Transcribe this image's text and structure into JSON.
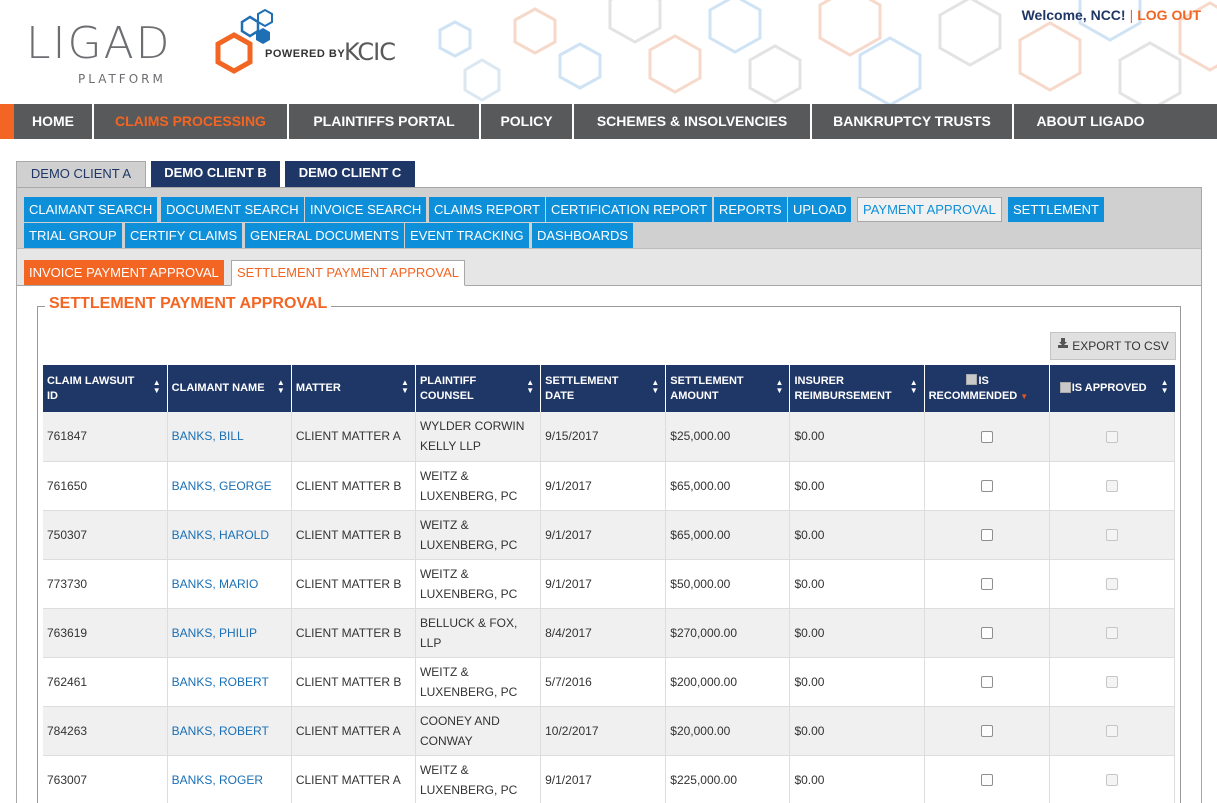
{
  "brand": {
    "logo_text": "LIGAD",
    "logo_sub": "PLATFORM",
    "powered_by": "POWERED BY",
    "partner": "KCIC"
  },
  "user": {
    "welcome": "Welcome, NCC!",
    "separator": "|",
    "logout": "LOG OUT"
  },
  "main_nav": [
    {
      "label": "HOME"
    },
    {
      "label": "CLAIMS PROCESSING",
      "active": true
    },
    {
      "label": "PLAINTIFFS PORTAL"
    },
    {
      "label": "POLICY"
    },
    {
      "label": "SCHEMES & INSOLVENCIES"
    },
    {
      "label": "BANKRUPTCY TRUSTS"
    },
    {
      "label": "ABOUT LIGADO"
    }
  ],
  "client_tabs": [
    {
      "label": "DEMO CLIENT A",
      "active": true
    },
    {
      "label": "DEMO CLIENT B"
    },
    {
      "label": "DEMO CLIENT C"
    }
  ],
  "sub_tabs": [
    {
      "label": "CLAIMANT SEARCH"
    },
    {
      "label": "DOCUMENT SEARCH"
    },
    {
      "label": "INVOICE SEARCH"
    },
    {
      "label": "CLAIMS REPORT"
    },
    {
      "label": "CERTIFICATION REPORT"
    },
    {
      "label": "REPORTS"
    },
    {
      "label": "UPLOAD"
    },
    {
      "label": "PAYMENT APPROVAL",
      "active": true
    },
    {
      "label": "SETTLEMENT"
    },
    {
      "label": "TRIAL GROUP"
    },
    {
      "label": "CERTIFY CLAIMS"
    },
    {
      "label": "GENERAL DOCUMENTS"
    },
    {
      "label": "EVENT TRACKING"
    },
    {
      "label": "DASHBOARDS"
    }
  ],
  "approval_tabs": [
    {
      "label": "INVOICE PAYMENT APPROVAL"
    },
    {
      "label": "SETTLEMENT PAYMENT APPROVAL",
      "active": true
    }
  ],
  "section_title": "SETTLEMENT PAYMENT APPROVAL",
  "export_label": "EXPORT TO CSV",
  "columns": {
    "c0": "CLAIM LAWSUIT ID",
    "c1": "CLAIMANT NAME",
    "c2": "MATTER",
    "c3": "PLAINTIFF COUNSEL",
    "c4": "SETTLEMENT DATE",
    "c5": "SETTLEMENT AMOUNT",
    "c6": "INSURER REIMBURSEMENT",
    "c7": "IS RECOMMENDED",
    "c8": "IS APPROVED"
  },
  "rows": [
    {
      "id": "761847",
      "name": "BANKS, BILL",
      "matter": "CLIENT MATTER A",
      "counsel": "WYLDER CORWIN KELLY LLP",
      "date": "9/15/2017",
      "amount": "$25,000.00",
      "reimb": "$0.00"
    },
    {
      "id": "761650",
      "name": "BANKS, GEORGE",
      "matter": "CLIENT MATTER B",
      "counsel": "WEITZ & LUXENBERG, PC",
      "date": "9/1/2017",
      "amount": "$65,000.00",
      "reimb": "$0.00"
    },
    {
      "id": "750307",
      "name": "BANKS, HAROLD",
      "matter": "CLIENT MATTER B",
      "counsel": "WEITZ & LUXENBERG, PC",
      "date": "9/1/2017",
      "amount": "$65,000.00",
      "reimb": "$0.00"
    },
    {
      "id": "773730",
      "name": "BANKS, MARIO",
      "matter": "CLIENT MATTER B",
      "counsel": "WEITZ & LUXENBERG, PC",
      "date": "9/1/2017",
      "amount": "$50,000.00",
      "reimb": "$0.00"
    },
    {
      "id": "763619",
      "name": "BANKS, PHILIP",
      "matter": "CLIENT MATTER B",
      "counsel": "BELLUCK & FOX, LLP",
      "date": "8/4/2017",
      "amount": "$270,000.00",
      "reimb": "$0.00"
    },
    {
      "id": "762461",
      "name": "BANKS, ROBERT",
      "matter": "CLIENT MATTER B",
      "counsel": "WEITZ & LUXENBERG, PC",
      "date": "5/7/2016",
      "amount": "$200,000.00",
      "reimb": "$0.00"
    },
    {
      "id": "784263",
      "name": "BANKS, ROBERT",
      "matter": "CLIENT MATTER A",
      "counsel": "COONEY AND CONWAY",
      "date": "10/2/2017",
      "amount": "$20,000.00",
      "reimb": "$0.00"
    },
    {
      "id": "763007",
      "name": "BANKS, ROGER",
      "matter": "CLIENT MATTER A",
      "counsel": "WEITZ & LUXENBERG, PC",
      "date": "9/1/2017",
      "amount": "$225,000.00",
      "reimb": "$0.00"
    }
  ],
  "colors": {
    "navy": "#1f3766",
    "orange": "#f26522",
    "blue": "#0d8fd9",
    "gray": "#58595b"
  },
  "icons": {
    "export": "download-icon",
    "sort": "sort-arrows-icon",
    "sort_desc": "sort-desc-icon"
  }
}
